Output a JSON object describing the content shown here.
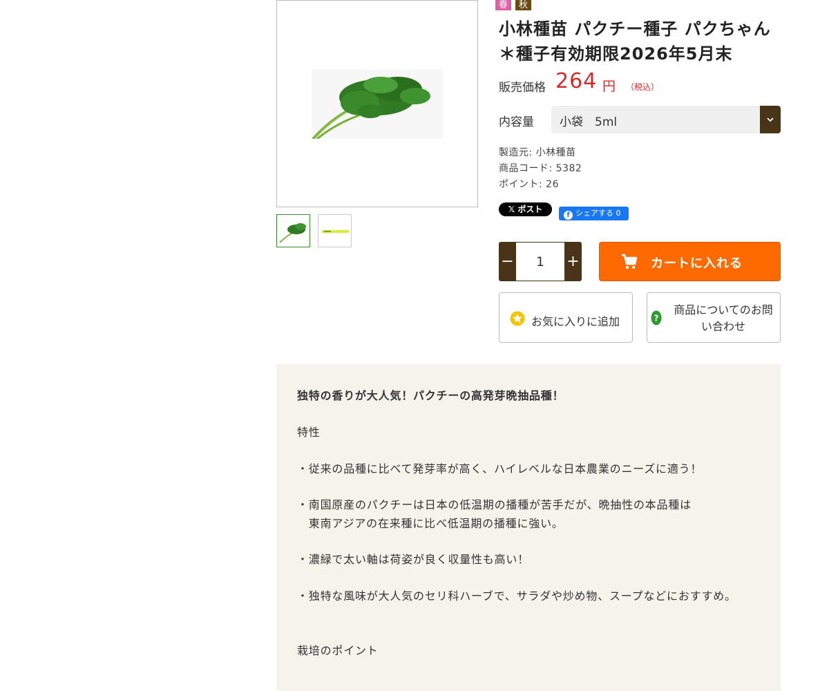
{
  "product": {
    "season_badges": [
      {
        "label": "春",
        "color": "#e060a8"
      },
      {
        "label": "秋",
        "color": "#6b4a10"
      }
    ],
    "title": "小林種苗 パクチー種子 パクちゃん ＊種子有効期限2026年5月末",
    "price": {
      "label": "販売価格",
      "value": "264",
      "unit": "円",
      "tax_note": "（税込）",
      "color": "#d42a2a"
    },
    "volume": {
      "label": "内容量",
      "selected": "小袋　5ml"
    },
    "meta": {
      "maker": "製造元: 小林種苗",
      "code": "商品コード: 5382",
      "points": "ポイント: 26"
    },
    "social": {
      "x_post": "ポスト",
      "fb_share": "シェアする 0"
    },
    "quantity": "1",
    "cart_button": "カートに入れる",
    "favorite_button": "お気に入りに追加",
    "inquiry_button": [
      "商品についてのお問",
      "い合わせ"
    ],
    "gallery": {
      "thumbnails": [
        "coriander-bunch-photo",
        "seed-packet-photo"
      ]
    }
  },
  "colors": {
    "accent_brown": "#4a3418",
    "cart_orange": "#ff6a00",
    "description_bg": "#f6f2ec"
  },
  "description": {
    "headline": "独特の香りが大人気！パクチーの高発芽晩抽品種！",
    "section1_title": "特性",
    "bullets": [
      "・従来の品種に比べて発芽率が高く、ハイレベルな日本農業のニーズに適う！",
      "・南国原産のパクチーは日本の低温期の播種が苦手だが、晩抽性の本品種は",
      "　東南アジアの在来種に比べ低温期の播種に強い。",
      "・濃緑で太い軸は荷姿が良く収量性も高い！",
      "・独特な風味が大人気のセリ科ハーブで、サラダや炒め物、スープなどにおすすめ。"
    ],
    "section2_title": "栽培のポイント"
  }
}
